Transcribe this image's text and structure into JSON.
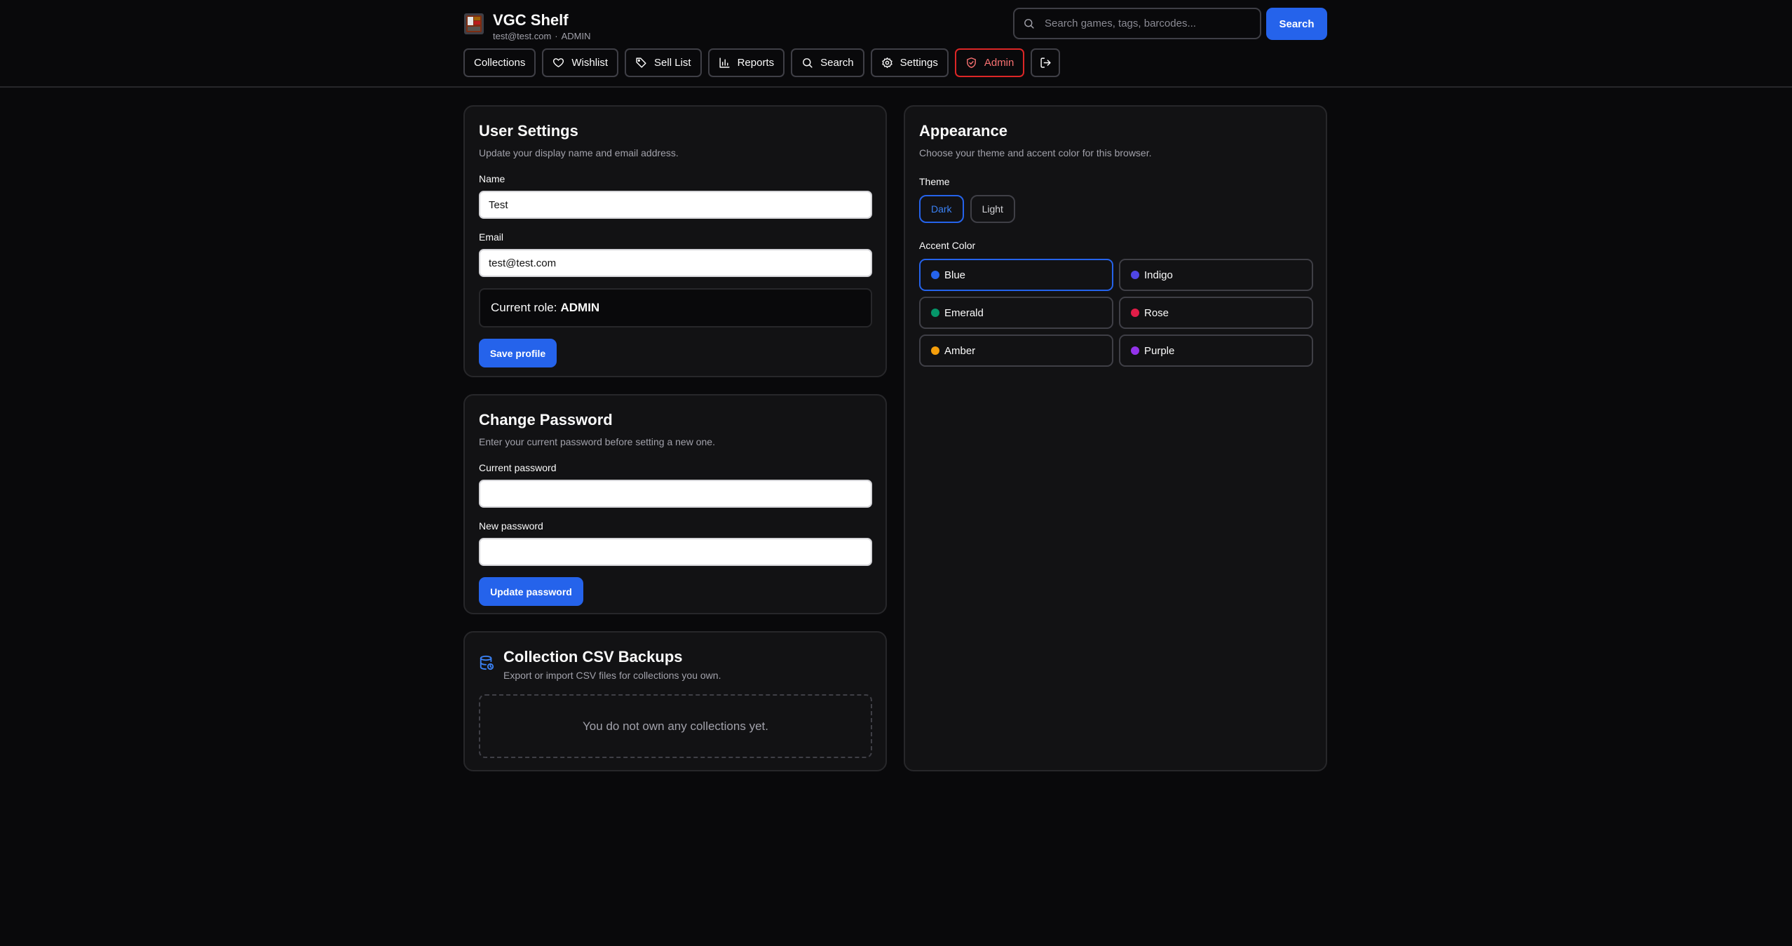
{
  "app": {
    "title": "VGC Shelf",
    "user_email": "test@test.com",
    "separator": "·",
    "user_role": "ADMIN"
  },
  "top_search": {
    "placeholder": "Search games, tags, barcodes...",
    "button_label": "Search"
  },
  "nav": {
    "collections": "Collections",
    "wishlist": "Wishlist",
    "sell_list": "Sell List",
    "reports": "Reports",
    "search": "Search",
    "settings": "Settings",
    "admin": "Admin"
  },
  "user_settings": {
    "title": "User Settings",
    "description": "Update your display name and email address.",
    "name_label": "Name",
    "name_value": "Test",
    "email_label": "Email",
    "email_value": "test@test.com",
    "role_prefix": "Current role:",
    "role_value": "ADMIN",
    "save_label": "Save profile"
  },
  "change_password": {
    "title": "Change Password",
    "description": "Enter your current password before setting a new one.",
    "current_label": "Current password",
    "new_label": "New password",
    "update_label": "Update password"
  },
  "csv_backups": {
    "title": "Collection CSV Backups",
    "description": "Export or import CSV files for collections you own.",
    "empty_message": "You do not own any collections yet."
  },
  "appearance": {
    "title": "Appearance",
    "description": "Choose your theme and accent color for this browser.",
    "theme_label": "Theme",
    "themes": [
      {
        "label": "Dark",
        "selected": true
      },
      {
        "label": "Light",
        "selected": false
      }
    ],
    "accent_label": "Accent Color",
    "accents": [
      {
        "label": "Blue",
        "color": "#2563eb",
        "selected": true
      },
      {
        "label": "Indigo",
        "color": "#4f46e5",
        "selected": false
      },
      {
        "label": "Emerald",
        "color": "#059669",
        "selected": false
      },
      {
        "label": "Rose",
        "color": "#e11d48",
        "selected": false
      },
      {
        "label": "Amber",
        "color": "#f59e0b",
        "selected": false
      },
      {
        "label": "Purple",
        "color": "#9333ea",
        "selected": false
      }
    ]
  },
  "colors": {
    "accent": "#2563eb",
    "danger": "#dc2626",
    "background": "#09090b",
    "card": "#121214"
  },
  "icons": {
    "logo": "game-cartridge-icon",
    "search": "search-icon",
    "wishlist": "heart-icon",
    "sell_list": "tag-icon",
    "reports": "bar-chart-icon",
    "settings": "gear-icon",
    "admin": "shield-icon",
    "logout": "logout-icon",
    "backups": "database-icon"
  }
}
